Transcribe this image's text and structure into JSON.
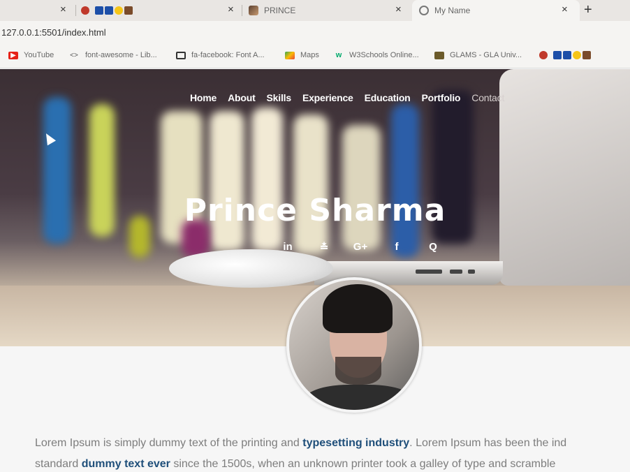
{
  "browser": {
    "tabs": [
      {
        "title": "",
        "icons": [
          "person-icon",
          "ps-icon",
          "emoji-icon",
          "family-icon"
        ]
      },
      {
        "title": "PRINCE"
      },
      {
        "title": "My Name"
      }
    ],
    "new_tab": "+",
    "close_glyph": "×",
    "url": "127.0.0.1:5501/index.html",
    "bookmarks": [
      {
        "label": "YouTube",
        "icon": "youtube-icon",
        "color": "#e62117"
      },
      {
        "label": "font-awesome - Lib...",
        "icon": "code-icon",
        "color": "#555555"
      },
      {
        "label": "fa-facebook: Font A...",
        "icon": "page-icon",
        "color": "#333333"
      },
      {
        "label": "Maps",
        "icon": "maps-icon",
        "color": "#34a853"
      },
      {
        "label": "W3Schools Online...",
        "icon": "w3schools-icon",
        "color": "#04aa6d"
      },
      {
        "label": "GLAMS - GLA Univ...",
        "icon": "glams-icon",
        "color": "#6b5a2a"
      }
    ]
  },
  "page": {
    "nav": [
      "Home",
      "About",
      "Skills",
      "Experience",
      "Education",
      "Portfolio",
      "Contact"
    ],
    "hero_name": "Prince Sharma",
    "social": [
      {
        "glyph": "in",
        "icon": "linkedin-icon"
      },
      {
        "glyph": "≛",
        "icon": "stackoverflow-icon"
      },
      {
        "glyph": "G+",
        "icon": "google-plus-icon"
      },
      {
        "glyph": "f",
        "icon": "facebook-icon"
      },
      {
        "glyph": "Q",
        "icon": "quora-icon"
      }
    ],
    "paragraph": {
      "line1_a": "Lorem Ipsum is simply dummy text of the printing and ",
      "line1_b": "typesetting industry",
      "line1_c": ". Lorem Ipsum has been the ind",
      "line2_a": "standard ",
      "line2_b": "dummy text ever",
      "line2_c": " since the 1500s, when an unknown printer took a galley of type and scramble"
    }
  }
}
